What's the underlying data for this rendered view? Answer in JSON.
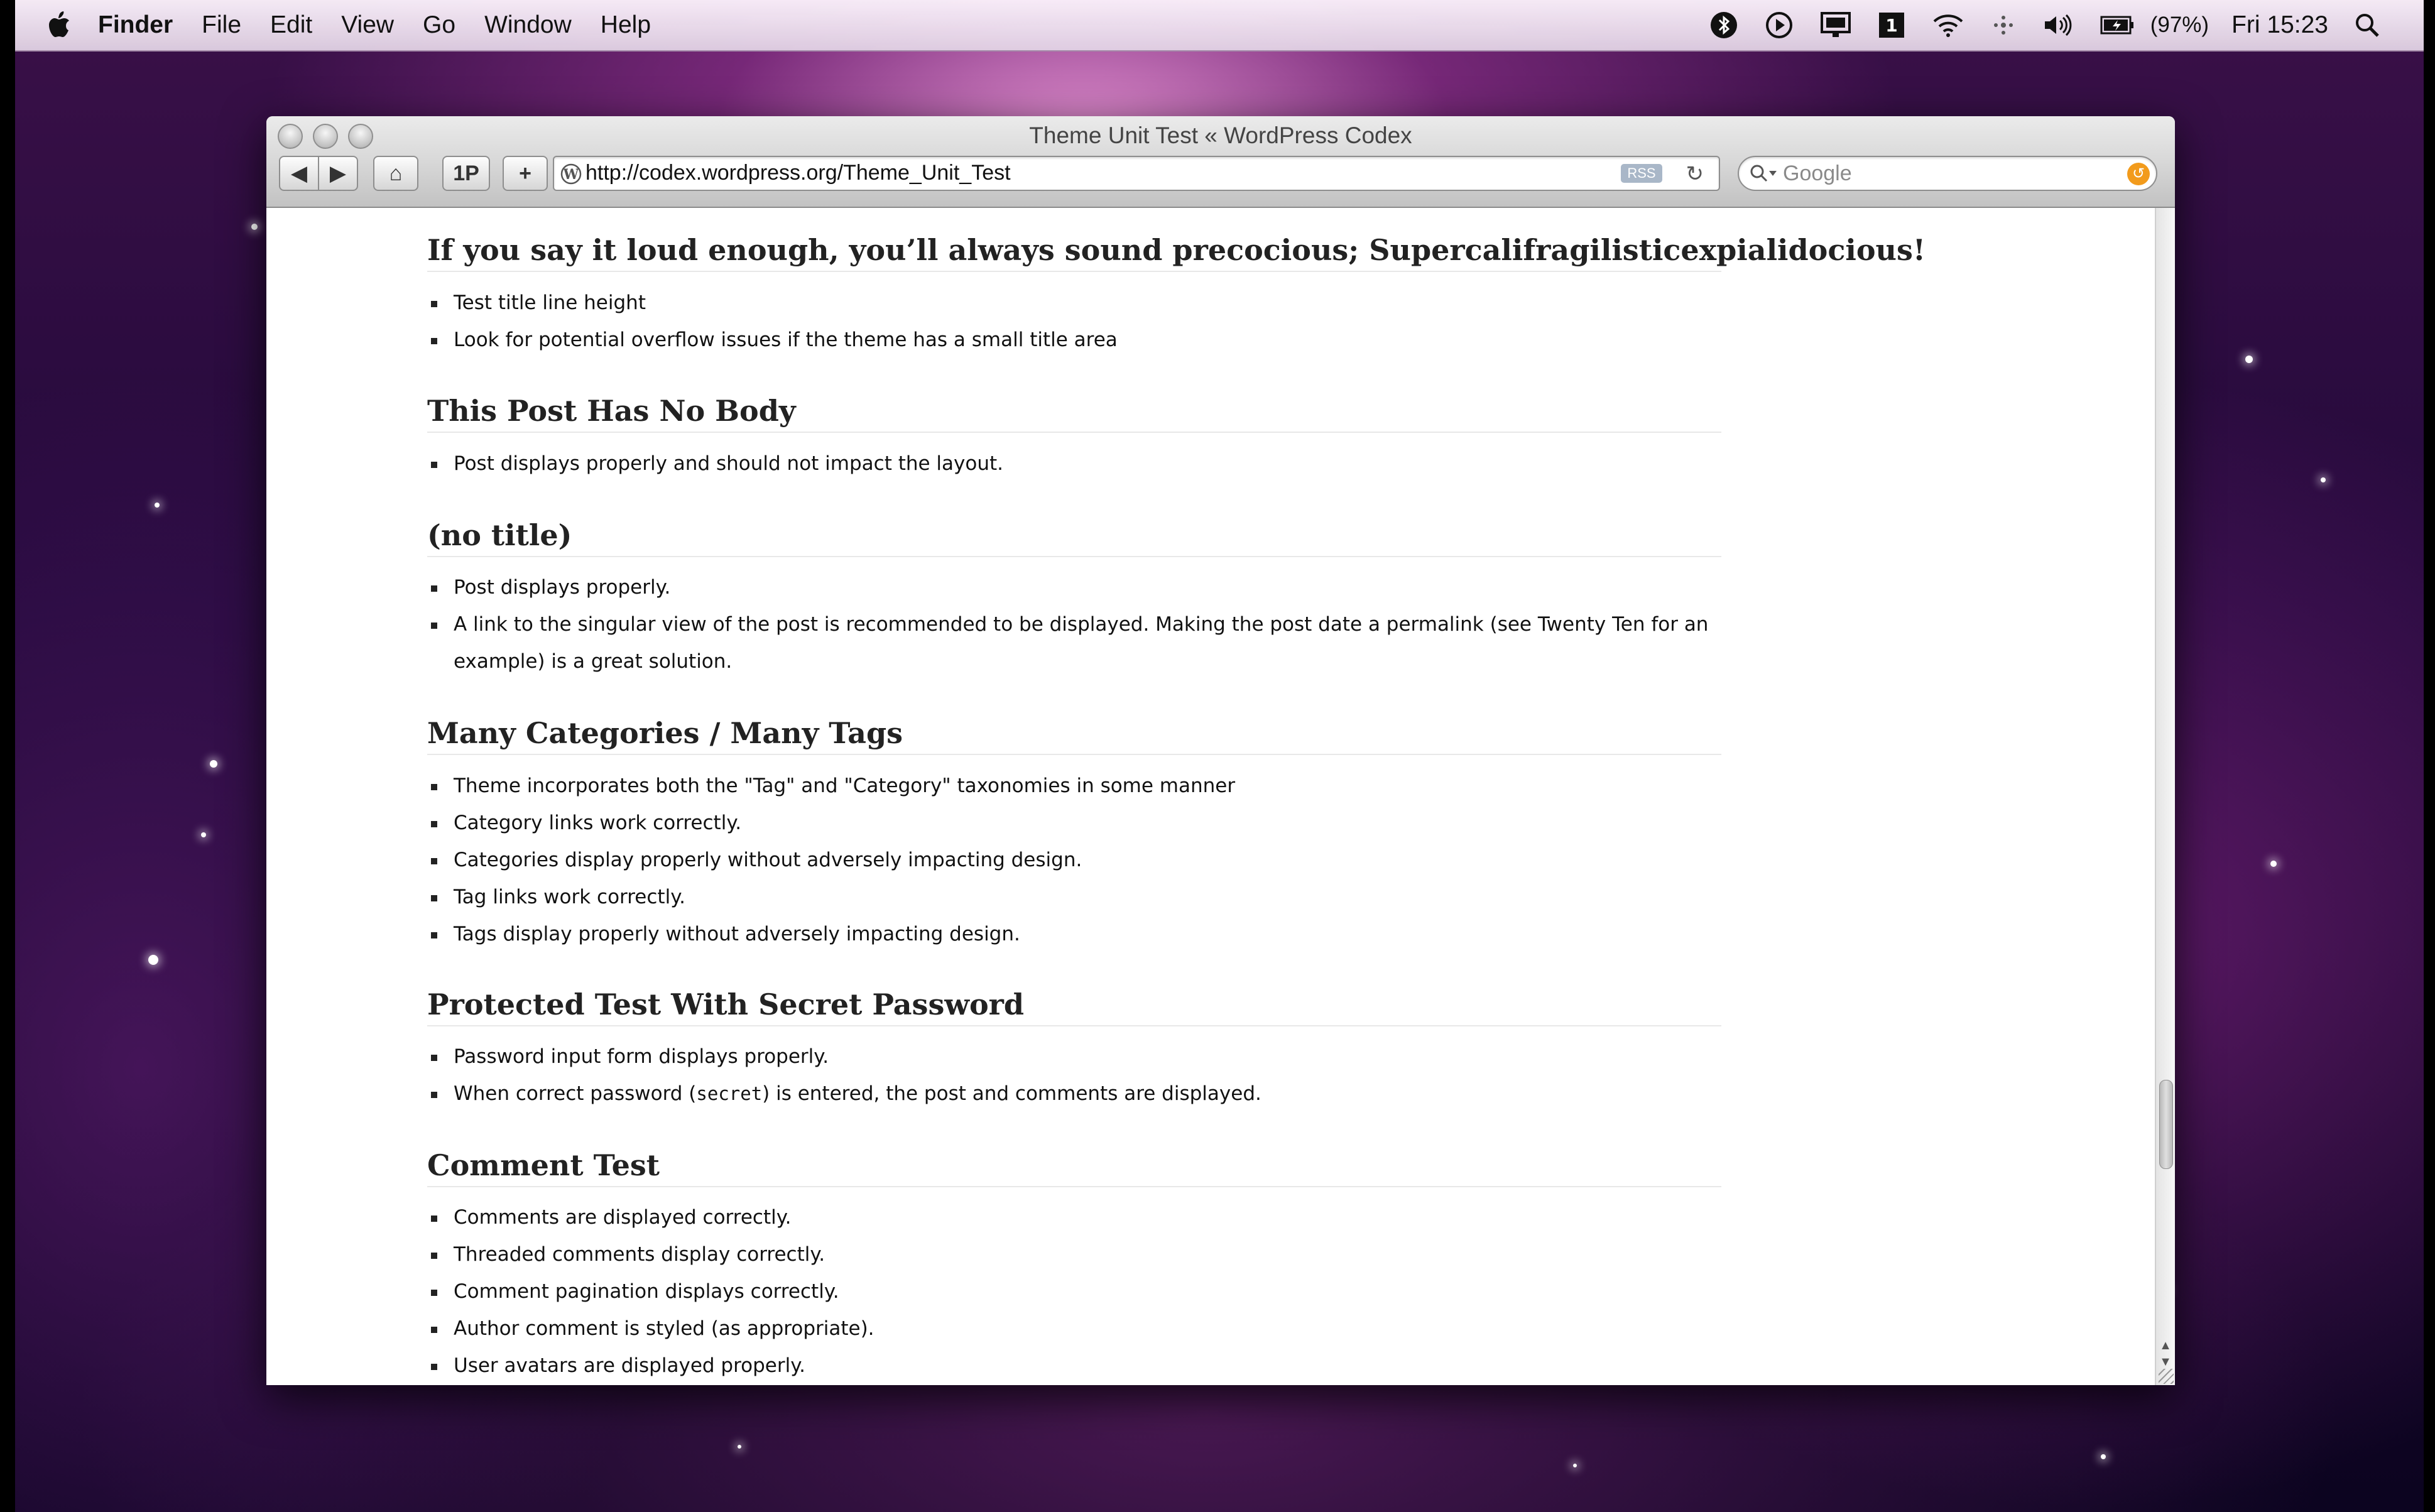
{
  "menubar": {
    "app_name": "Finder",
    "items": [
      "File",
      "Edit",
      "View",
      "Go",
      "Window",
      "Help"
    ],
    "battery_text": "(97%)",
    "clock": "Fri 15:23",
    "status_icons": [
      "bluetooth-icon",
      "play-icon",
      "display-icon",
      "keyboard-layout-icon",
      "wifi-icon",
      "sync-icon",
      "volume-icon",
      "battery-icon",
      "spotlight-icon"
    ]
  },
  "browser": {
    "title": "Theme Unit Test « WordPress Codex",
    "toolbar": {
      "back_label": "◀",
      "forward_label": "▶",
      "home_label": "⌂",
      "onepassword_label": "1P",
      "add_label": "+",
      "url": "http://codex.wordpress.org/Theme_Unit_Test",
      "rss_label": "RSS",
      "reload_label": "↻",
      "search_placeholder": "Google"
    }
  },
  "page": {
    "sections": [
      {
        "heading": "If you say it loud enough, you’ll always sound precocious; Supercalifragilisticexpialidocious!",
        "items": [
          "Test title line height",
          "Look for potential overflow issues if the theme has a small title area"
        ]
      },
      {
        "heading": "This Post Has No Body",
        "items": [
          "Post displays properly and should not impact the layout."
        ]
      },
      {
        "heading": "(no title)",
        "items": [
          "Post displays properly.",
          "A link to the singular view of the post is recommended to be displayed. Making the post date a permalink (see Twenty Ten for an example) is a great solution."
        ]
      },
      {
        "heading": "Many Categories / Many Tags",
        "items": [
          "Theme incorporates both the \"Tag\" and \"Category\" taxonomies in some manner",
          "Category links work correctly.",
          "Categories display properly without adversely impacting design.",
          "Tag links work correctly.",
          "Tags display properly without adversely impacting design."
        ]
      },
      {
        "heading": "Protected Test With Secret Password",
        "items": [
          "Password input form displays properly."
        ],
        "password_item": {
          "before": "When correct password (",
          "code": "secret",
          "after": ") is entered, the post and comments are displayed."
        }
      },
      {
        "heading": "Comment Test",
        "items": [
          "Comments are displayed correctly.",
          "Threaded comments display correctly.",
          "Comment pagination displays correctly.",
          "Author comment is styled (as appropriate).",
          "User avatars are displayed properly."
        ]
      }
    ]
  }
}
